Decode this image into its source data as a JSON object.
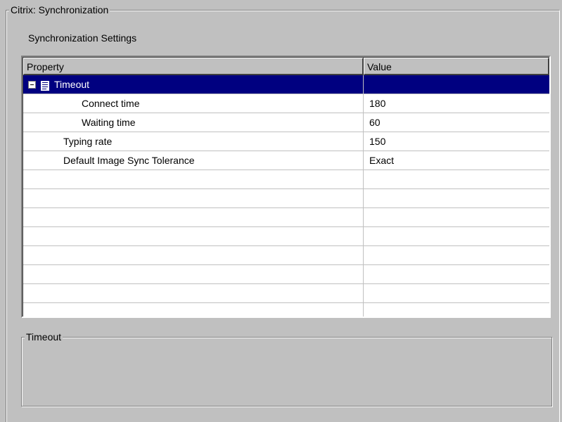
{
  "group_title": "Citrix: Synchronization",
  "section_label": "Synchronization Settings",
  "grid": {
    "headers": {
      "property": "Property",
      "value": "Value"
    },
    "rows": [
      {
        "property": "Timeout",
        "value": ""
      },
      {
        "property": "Connect time",
        "value": "180"
      },
      {
        "property": "Waiting time",
        "value": "60"
      },
      {
        "property": "Typing rate",
        "value": "150"
      },
      {
        "property": "Default Image Sync Tolerance",
        "value": "Exact"
      }
    ]
  },
  "description": {
    "title": "Timeout"
  },
  "colors": {
    "selection": "#000080",
    "face": "#c0c0c0"
  },
  "icons": {
    "expander": "collapse-minus-icon",
    "node": "property-page-icon"
  }
}
